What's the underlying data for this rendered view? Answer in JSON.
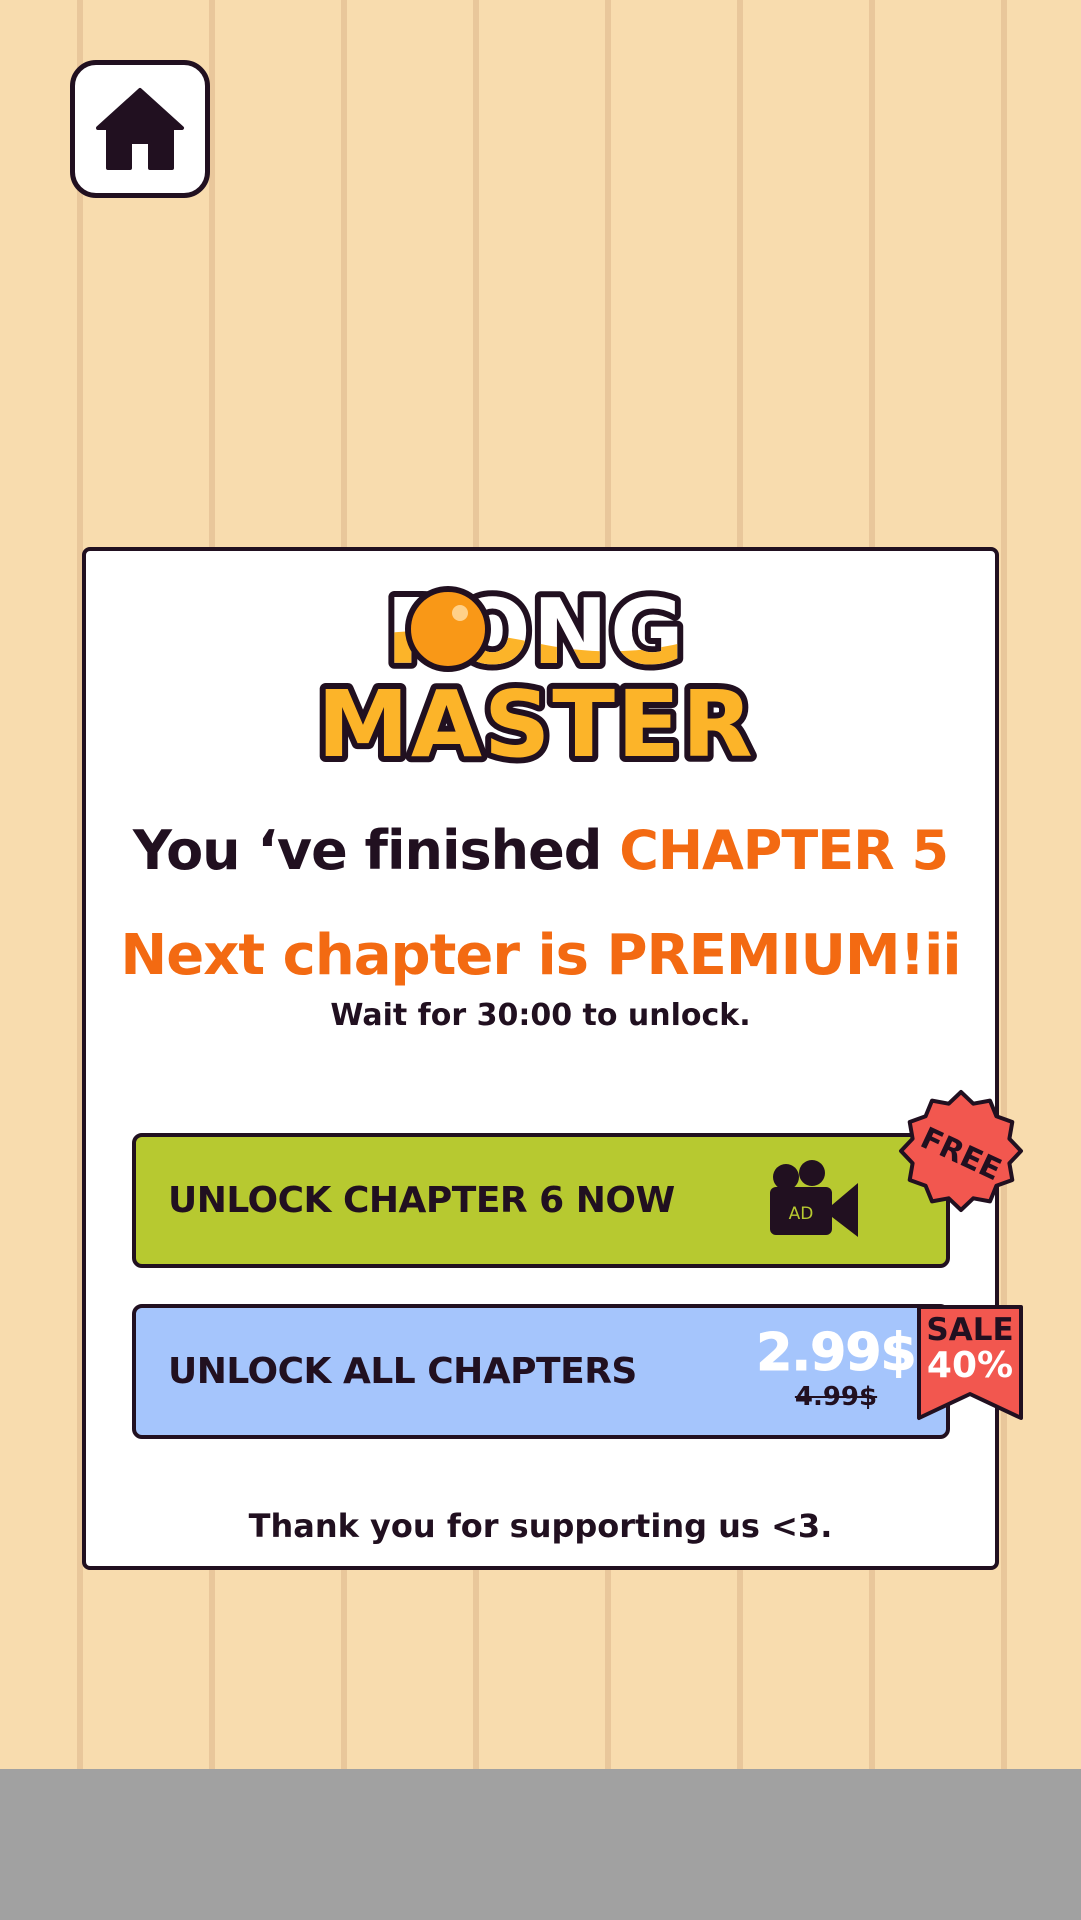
{
  "logo": {
    "line1": "PONG",
    "line2": "MASTER"
  },
  "message": {
    "finished_prefix": "You ‘ve finished",
    "finished_chapter": "CHAPTER 5",
    "premium": "Next chapter is PREMIUM!ii",
    "wait": "Wait for 30:00 to unlock."
  },
  "buttons": {
    "unlock_chapter": {
      "label": "UNLOCK CHAPTER 6 NOW",
      "ad_label": "AD",
      "badge": "FREE"
    },
    "unlock_all": {
      "label": "UNLOCK ALL CHAPTERS",
      "price": "2.99$",
      "old_price": "4.99$",
      "sale_word": "SALE",
      "sale_percent": "40%"
    }
  },
  "footer": {
    "thanks": "Thank you for supporting us <3."
  },
  "colors": {
    "background": "#f8dcae",
    "accent_orange": "#f36a12",
    "green_button": "#b7c930",
    "blue_button": "#a5c5fc",
    "badge_red": "#f2574f",
    "outline": "#211020"
  },
  "icons": [
    "home-icon",
    "video-camera-icon"
  ]
}
